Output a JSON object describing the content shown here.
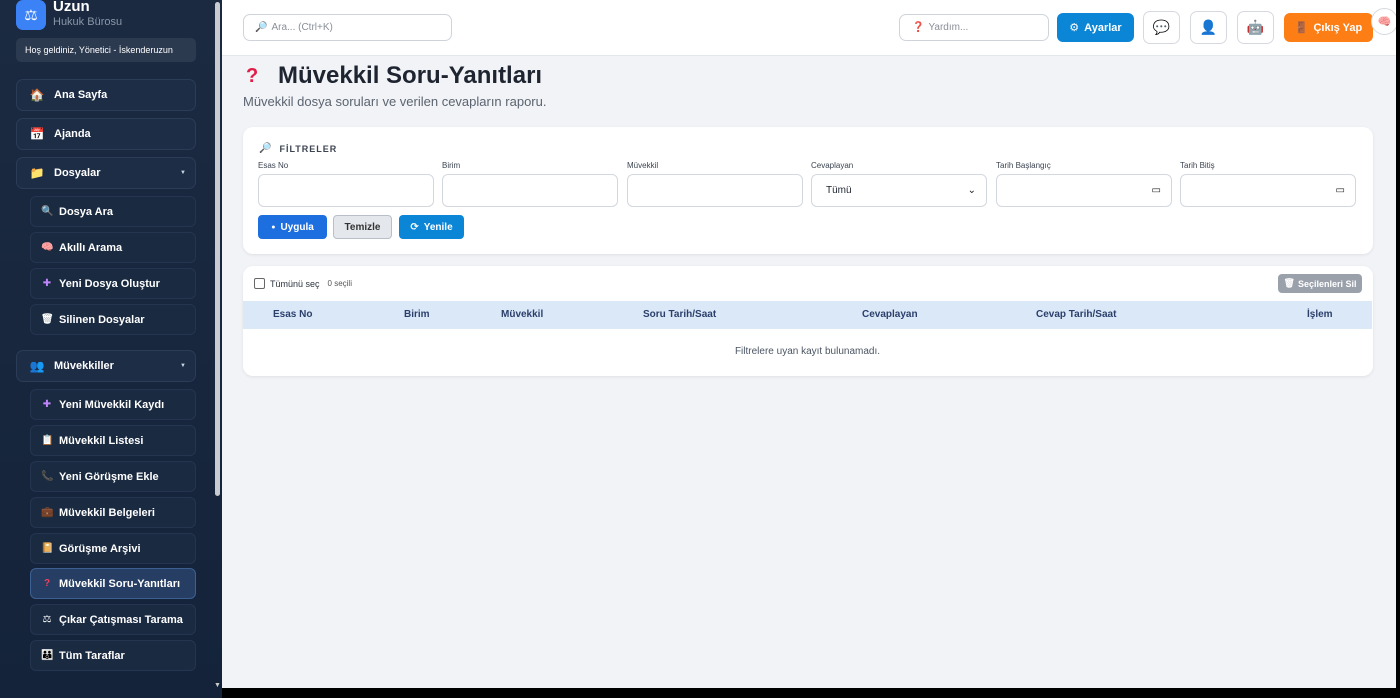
{
  "brand": {
    "name": "Uzun",
    "subtitle": "Hukuk Bürosu"
  },
  "welcome": "Hoş geldiniz, Yönetici - İskenderuzun",
  "nav": {
    "home": "Ana Sayfa",
    "agenda": "Ajanda",
    "files": "Dosyalar",
    "files_sub": [
      "Dosya Ara",
      "Akıllı Arama",
      "Yeni Dosya Oluştur",
      "Silinen Dosyalar"
    ],
    "clients": "Müvekkiller",
    "clients_sub": [
      "Yeni Müvekkil Kaydı",
      "Müvekkil Listesi",
      "Yeni Görüşme Ekle",
      "Müvekkil Belgeleri",
      "Görüşme Arşivi",
      "Müvekkil Soru-Yanıtları",
      "Çıkar Çatışması Tarama",
      "Tüm Taraflar"
    ]
  },
  "topbar": {
    "search_placeholder": "Ara... (Ctrl+K)",
    "help_placeholder": "Yardım...",
    "settings": "Ayarlar",
    "logout": "Çıkış Yap"
  },
  "page": {
    "title": "Müvekkil Soru-Yanıtları",
    "subtitle": "Müvekkil dosya soruları ve verilen cevapların raporu."
  },
  "filters": {
    "heading": "FİLTRELER",
    "labels": [
      "Esas No",
      "Birim",
      "Müvekkil",
      "Cevaplayan",
      "Tarih Başlangıç",
      "Tarih Bitiş"
    ],
    "answerer_value": "Tümü",
    "apply": "Uygula",
    "clear": "Temizle",
    "refresh": "Yenile"
  },
  "table": {
    "select_all": "Tümünü seç",
    "selected_count": "0 seçili",
    "delete_selected": "Seçilenleri Sil",
    "columns": [
      "Esas No",
      "Birim",
      "Müvekkil",
      "Soru Tarih/Saat",
      "Cevaplayan",
      "Cevap Tarih/Saat",
      "İşlem"
    ],
    "empty_message": "Filtrelere uyan kayıt bulunamadı."
  }
}
